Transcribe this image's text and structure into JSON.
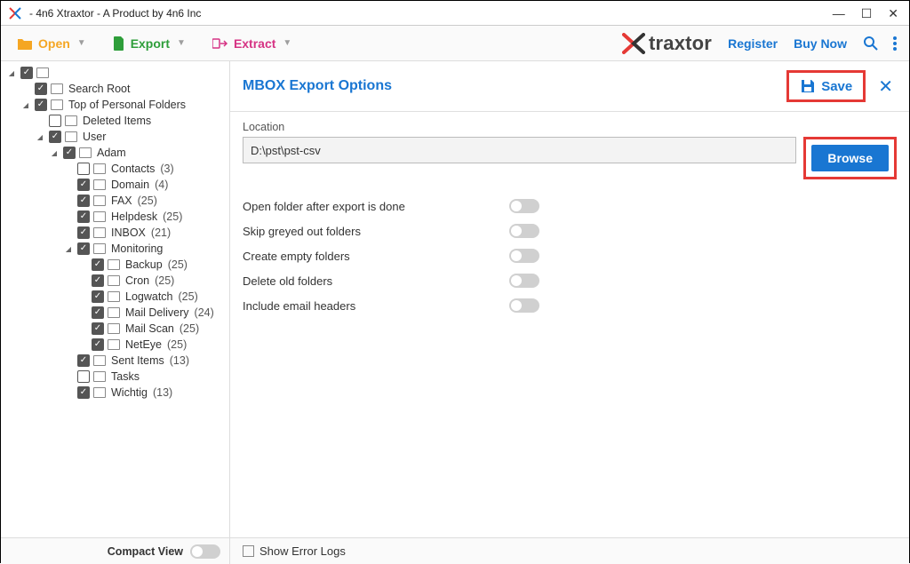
{
  "window": {
    "title": "- 4n6 Xtraxtor - A Product by 4n6 Inc"
  },
  "toolbar": {
    "open": "Open",
    "export": "Export",
    "extract": "Extract",
    "brand": "traxtor",
    "register": "Register",
    "buy_now": "Buy Now"
  },
  "tree": [
    {
      "indent": 0,
      "exp": "▾",
      "chk": true,
      "label": ""
    },
    {
      "indent": 1,
      "exp": "",
      "chk": true,
      "label": "Search Root"
    },
    {
      "indent": 1,
      "exp": "▾",
      "chk": true,
      "label": "Top of Personal Folders"
    },
    {
      "indent": 2,
      "exp": "",
      "chk": false,
      "label": "Deleted Items",
      "icon": "trash"
    },
    {
      "indent": 2,
      "exp": "▾",
      "chk": true,
      "label": "User"
    },
    {
      "indent": 3,
      "exp": "▾",
      "chk": true,
      "label": "Adam"
    },
    {
      "indent": 4,
      "exp": "",
      "chk": false,
      "label": "Contacts",
      "count": "(3)"
    },
    {
      "indent": 4,
      "exp": "",
      "chk": true,
      "label": "Domain",
      "count": "(4)"
    },
    {
      "indent": 4,
      "exp": "",
      "chk": true,
      "label": "FAX",
      "count": "(25)"
    },
    {
      "indent": 4,
      "exp": "",
      "chk": true,
      "label": "Helpdesk",
      "count": "(25)"
    },
    {
      "indent": 4,
      "exp": "",
      "chk": true,
      "label": "INBOX",
      "count": "(21)",
      "icon": "mail"
    },
    {
      "indent": 4,
      "exp": "▾",
      "chk": true,
      "label": "Monitoring"
    },
    {
      "indent": 5,
      "exp": "",
      "chk": true,
      "label": "Backup",
      "count": "(25)"
    },
    {
      "indent": 5,
      "exp": "",
      "chk": true,
      "label": "Cron",
      "count": "(25)"
    },
    {
      "indent": 5,
      "exp": "",
      "chk": true,
      "label": "Logwatch",
      "count": "(25)"
    },
    {
      "indent": 5,
      "exp": "",
      "chk": true,
      "label": "Mail Delivery",
      "count": "(24)"
    },
    {
      "indent": 5,
      "exp": "",
      "chk": true,
      "label": "Mail Scan",
      "count": "(25)"
    },
    {
      "indent": 5,
      "exp": "",
      "chk": true,
      "label": "NetEye",
      "count": "(25)"
    },
    {
      "indent": 4,
      "exp": "",
      "chk": true,
      "label": "Sent Items",
      "count": "(13)",
      "icon": "sent"
    },
    {
      "indent": 4,
      "exp": "",
      "chk": false,
      "label": "Tasks",
      "icon": "task"
    },
    {
      "indent": 4,
      "exp": "",
      "chk": true,
      "label": "Wichtig",
      "count": "(13)"
    }
  ],
  "panel": {
    "title": "MBOX Export Options",
    "save": "Save",
    "location_label": "Location",
    "location_value": "D:\\pst\\pst-csv",
    "browse": "Browse",
    "options": [
      "Open folder after export is done",
      "Skip greyed out folders",
      "Create empty folders",
      "Delete old folders",
      "Include email headers"
    ]
  },
  "footer": {
    "compact_view": "Compact View",
    "show_error_logs": "Show Error Logs"
  }
}
